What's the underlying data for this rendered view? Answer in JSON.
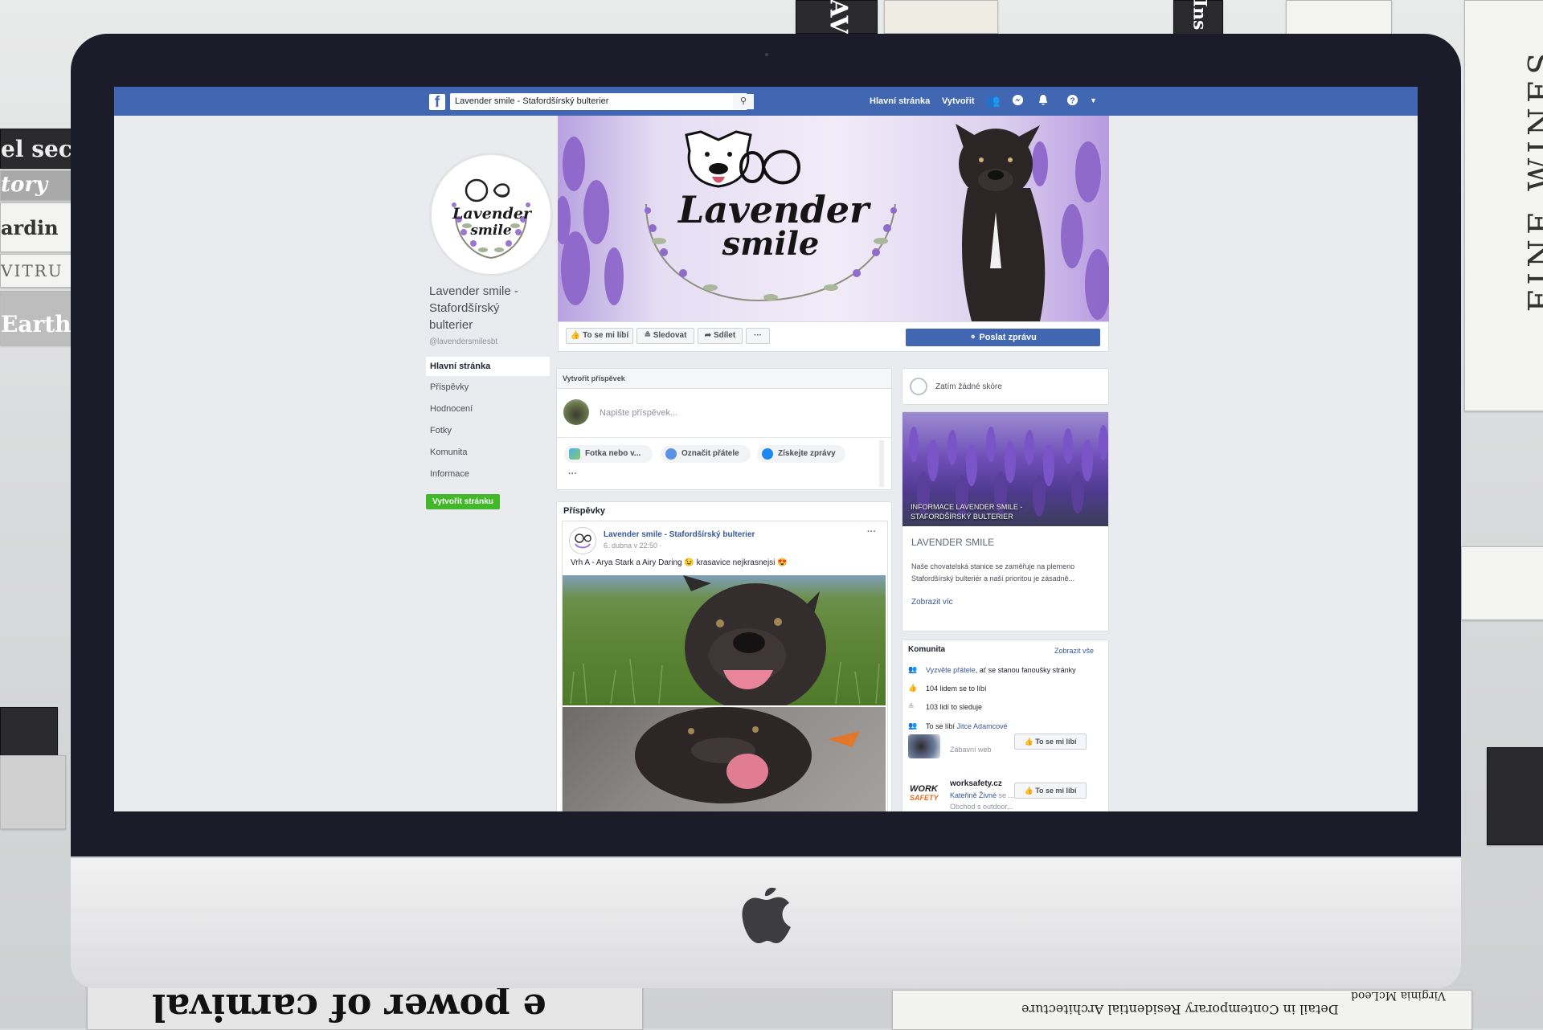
{
  "background": {
    "left_books": [
      "el secur",
      "tory",
      "ardin",
      "VITRU",
      "Earth"
    ],
    "right_book_spine": "FINE WINES",
    "bottom_book_mirrored": "e power of carnival",
    "bottom_right_book_mirrored": "Detail in Contemporary Residential Architecture",
    "bottom_right_author": "Virginia McLeod",
    "top_book_1": "AV",
    "top_book_2": "Ins"
  },
  "screen": {
    "topbar": {
      "search_value": "Lavender smile - Stafordšírský bulterier",
      "nav_home": "Hlavní stránka",
      "nav_create": "Vytvořit"
    },
    "left": {
      "page_name": "Lavender smile - Stafordšírský bulterier",
      "handle": "@lavendersmilesbt",
      "menu": [
        "Hlavní stránka",
        "Příspěvky",
        "Hodnocení",
        "Fotky",
        "Komunita",
        "Informace"
      ],
      "create_page_button": "Vytvořit stránku",
      "profile_logo_line1": "Lavender",
      "profile_logo_line2": "smile"
    },
    "cover": {
      "logo_line1": "Lavender",
      "logo_line2": "smile"
    },
    "action_bar": {
      "like": "To se mi líbí",
      "follow": "Sledovat",
      "share": "Sdílet",
      "more": "···",
      "message": "Poslat zprávu"
    },
    "composer": {
      "title": "Vytvořit příspěvek",
      "placeholder": "Napište příspěvek...",
      "photo": "Fotka nebo v...",
      "tag": "Označit přátele",
      "messages": "Získejte zprávy",
      "more": "···"
    },
    "posts": {
      "header": "Příspěvky",
      "author": "Lavender smile - Stafordšírský bulterier",
      "date": "6. dubna v 22:50 ·",
      "text": "Vrh A - Arya Stark a Airy Daring 😉 krasavice nejkrasnejsi 😍",
      "more": "···"
    },
    "right": {
      "rating": "Zatím žádné skóre",
      "info_overlay": "INFORMACE LAVENDER SMILE - STAFORDŠÍRSKÝ BULTERIER",
      "about_title": "LAVENDER SMILE",
      "about_text": "Naše chovatelská stanice se zaměřuje na plemeno Stafordšírský bulteriér a naší prioritou je zásadně...",
      "show_more": "Zobrazit víc",
      "community_title": "Komunita",
      "community_show_all": "Zobrazit vše",
      "invite_link": "Vyzvěte přátele",
      "invite_rest": ", ať se stanou fanoušky stránky",
      "likes": "104 lidem se to líbí",
      "followers": "103 lidí to sleduje",
      "liked_by_prefix": "To se líbí",
      "liked_by_name": "Jitce Adamcové",
      "suggestion1_sub": "Zábavní web",
      "suggestion2_name": "worksafety.cz",
      "suggestion2_friend": "Kateřině Živné",
      "suggestion2_friend_rest": "se ...",
      "suggestion2_sub": "Obchod s outdoor...",
      "like_btn": "To se mi líbí",
      "ws_logo_line1": "WORK",
      "ws_logo_line2": "SAFETY"
    }
  }
}
